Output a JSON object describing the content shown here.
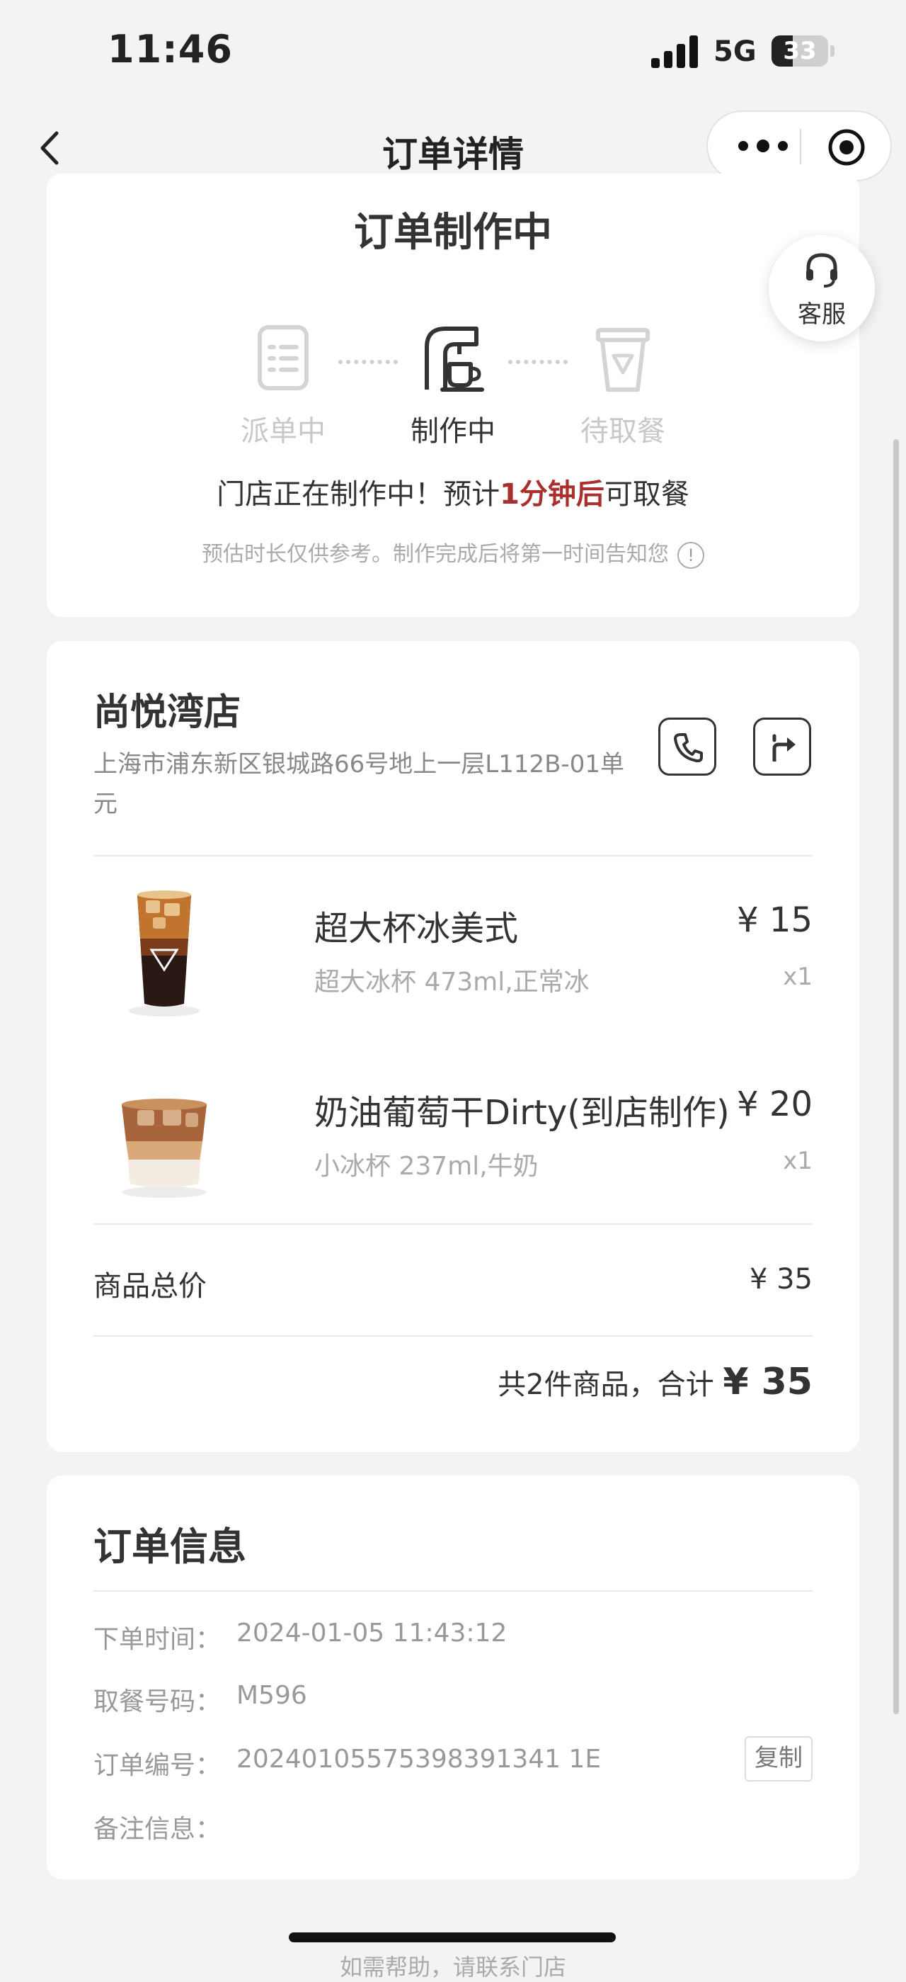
{
  "status_bar": {
    "time": "11:46",
    "network": "5G",
    "battery": "33"
  },
  "nav": {
    "title": "订单详情"
  },
  "status": {
    "title": "订单制作中",
    "steps": [
      {
        "label": "派单中",
        "icon": "list-icon",
        "state": "done"
      },
      {
        "label": "制作中",
        "icon": "coffee-machine-icon",
        "state": "active"
      },
      {
        "label": "待取餐",
        "icon": "cup-icon",
        "state": "pending"
      }
    ],
    "message_prefix": "门店正在制作中！预计",
    "message_highlight": "1分钟后",
    "message_suffix": "可取餐",
    "note": "预估时长仅供参考。制作完成后将第一时间告知您",
    "highlight_color": "#a8302e"
  },
  "service": {
    "label": "客服"
  },
  "store": {
    "name": "尚悦湾店",
    "address": "上海市浦东新区银城路66号地上一层L112B-01单元"
  },
  "items": [
    {
      "name": "超大杯冰美式",
      "spec": "超大冰杯 473ml,正常冰",
      "price": "¥ 15",
      "qty": "x1"
    },
    {
      "name": "奶油葡萄干Dirty(到店制作)",
      "spec": "小冰杯 237ml,牛奶",
      "price": "¥ 20",
      "qty": "x1"
    }
  ],
  "summary": {
    "subtotal_label": "商品总价",
    "subtotal_value": "¥ 35",
    "total_prefix": "共2件商品，合计",
    "total_value": "¥ 35"
  },
  "order_info": {
    "title": "订单信息",
    "rows": [
      {
        "key": "下单时间：",
        "value": "2024-01-05 11:43:12"
      },
      {
        "key": "取餐号码：",
        "value": "M596"
      },
      {
        "key": "订单编号：",
        "value": "20240105575398391341 1E"
      },
      {
        "key": "备注信息：",
        "value": ""
      }
    ],
    "copy_label": "复制"
  },
  "bottom_hint": "如需帮助，请联系门店"
}
